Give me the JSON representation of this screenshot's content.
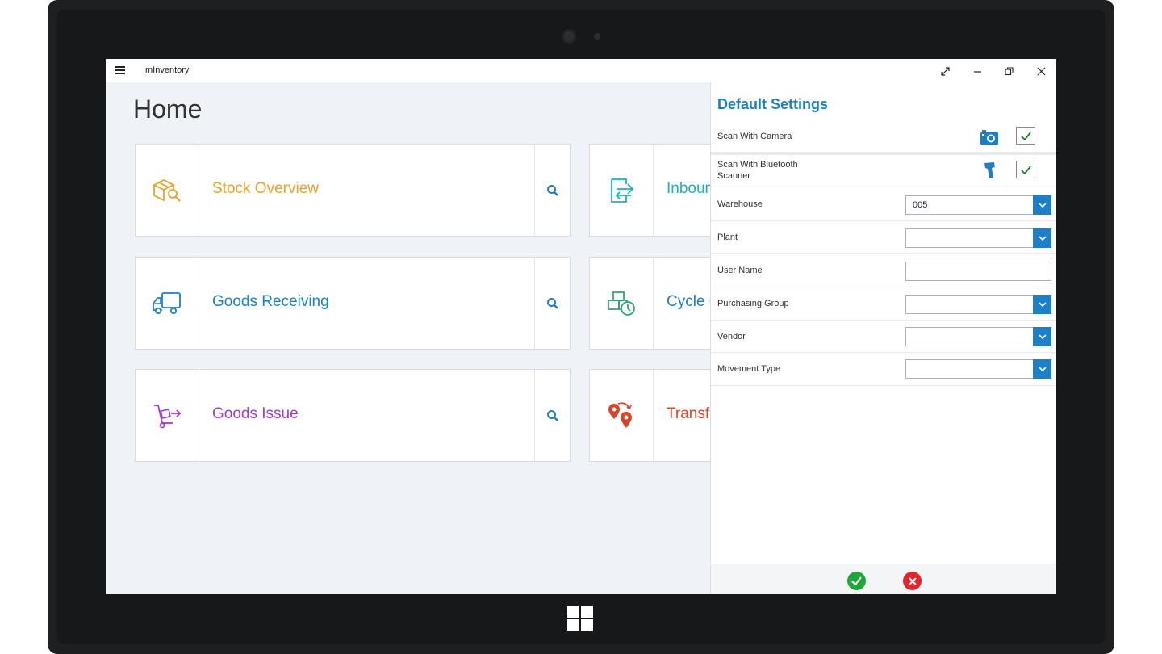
{
  "app": {
    "title": "mInventory"
  },
  "page": {
    "title": "Home"
  },
  "tiles": [
    {
      "label": "Stock Overview",
      "color": "#e8a22a",
      "icon": "box-search-icon"
    },
    {
      "label": "Inbound Delivery",
      "visible_label": "Inboun",
      "color": "#1ab3b8",
      "icon": "inbound-icon"
    },
    {
      "label": "Goods Receiving",
      "color": "#1c7fc8",
      "icon": "truck-icon"
    },
    {
      "label": "Cycle Count",
      "visible_label": "Cycle C",
      "color": "#1c7fc8",
      "icon": "boxes-clock-icon"
    },
    {
      "label": "Goods Issue",
      "color": "#a23bc9",
      "icon": "hand-truck-icon"
    },
    {
      "label": "Transfer Posting",
      "visible_label": "Transfe",
      "color": "#d9452a",
      "icon": "location-pins-icon"
    }
  ],
  "settings": {
    "title": "Default Settings",
    "scan_camera": {
      "label": "Scan With Camera",
      "checked": true,
      "icon": "camera-icon"
    },
    "scan_bluetooth": {
      "label_line1": "Scan With Bluetooth",
      "label_line2": "Scanner",
      "checked": true,
      "icon": "barcode-scanner-icon"
    },
    "warehouse": {
      "label": "Warehouse",
      "value": "005"
    },
    "plant": {
      "label": "Plant",
      "value": ""
    },
    "user_name": {
      "label": "User Name",
      "value": ""
    },
    "purchasing_group": {
      "label": "Purchasing Group",
      "value": ""
    },
    "vendor": {
      "label": "Vendor",
      "value": ""
    },
    "movement_type": {
      "label": "Movement Type",
      "value": ""
    }
  },
  "colors": {
    "accent": "#1c7fc8",
    "confirm": "#1fa83a",
    "cancel": "#e0262b"
  }
}
